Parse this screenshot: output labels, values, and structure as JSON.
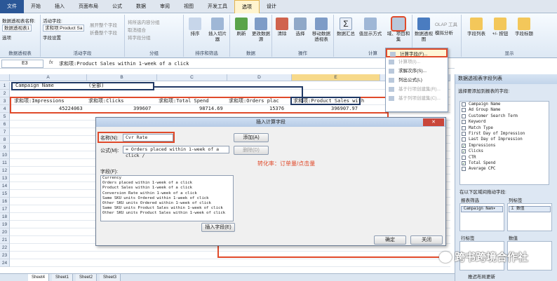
{
  "ribbon_tabs": [
    "文件",
    "开始",
    "插入",
    "页面布局",
    "公式",
    "数据",
    "审阅",
    "视图",
    "开发工具",
    "选项",
    "设计"
  ],
  "ribbon": {
    "pivot_name_label": "数据透视表名称:",
    "pivot_name": "数据透视表1",
    "active_field_label": "活动字段:",
    "active_field": "求和项:Product Sa",
    "options": "选项",
    "field_settings": "字段设置",
    "expand": "展开整个字段",
    "collapse": "折叠整个字段",
    "group_sel": "将所选内容分组",
    "ungroup": "取消组合",
    "group_field": "将字段分组",
    "sort": "排序",
    "insert_slicer": "插入切片器",
    "refresh": "刷新",
    "change_source": "更改数据源",
    "clear": "清除",
    "select": "选择",
    "move_pivot": "移动数据透视表",
    "summarize": "数据汇总",
    "show_values_as": "值显示方式",
    "fields_items_sets": "域、项目和集",
    "pivot_chart": "数据透视图",
    "olap": "OLAP 工具",
    "what_if": "模拟分析",
    "field_list": "字段列表",
    "plus_minus": "+/- 按钮",
    "field_headers": "字段标题",
    "groups": [
      "数据透视表",
      "活动字段",
      "分组",
      "排序和筛选",
      "数据",
      "操作",
      "计算",
      "工具",
      "显示"
    ]
  },
  "menu": {
    "items": [
      "计算字段(F)...",
      "计算项(I)...",
      "求解次序(S)...",
      "列出公式(L)",
      "基于行项创建集(R)...",
      "基于列项创建集(C)..."
    ],
    "dim": [
      false,
      true,
      false,
      false,
      true,
      true
    ]
  },
  "formula_bar": {
    "cell": "E3",
    "fx": "fx",
    "formula": "求和项:Product Sales within 1-week of a click"
  },
  "columns": [
    "A",
    "B",
    "C",
    "D",
    "E"
  ],
  "rows": [
    "1",
    "2",
    "3",
    "4",
    "5",
    "6",
    "7",
    "8",
    "9",
    "10",
    "11",
    "12",
    "13",
    "14",
    "15",
    "16",
    "17",
    "18",
    "19",
    "20",
    "21",
    "22",
    "23",
    "24"
  ],
  "sheet": {
    "filter_label": "Campaign Name",
    "filter_value": "(全部)",
    "headers": [
      "求和项:Impressions",
      "求和项:Clicks",
      "求和项:Total Spend",
      "求和项:Orders plac",
      "求和项:Product Sales with"
    ],
    "values": [
      "45224063",
      "399607",
      "98714.69",
      "15376",
      "396907.97"
    ]
  },
  "dialog": {
    "title": "插入计算字段",
    "close": "✕",
    "name_label": "名称(N):",
    "name_value": "Cvr Rate",
    "formula_label": "公式(M):",
    "formula_value": "= Orders placed within 1-week of a click /",
    "add": "添加(A)",
    "delete": "删除(D)",
    "annotation": "转化率：订单量/点击量",
    "fields_label": "字段(F):",
    "fields": [
      "Currency",
      "Orders placed within 1-week of a click",
      "Product Sales within 1-week of a click",
      "Conversion Rate within 1-week of a click",
      "Same SKU units Ordered within 1-week of click",
      "Other SKU units Ordered within 1-week of click",
      "Same SKU units Product Sales within 1-week of click",
      "Other SKU units Product Sales within 1-week of click"
    ],
    "insert_field": "插入字段(E)",
    "ok": "确定",
    "cancel": "关闭"
  },
  "pane": {
    "title": "数据透视表字段列表",
    "subtitle": "选择要添加到报表的字段:",
    "fields": [
      "Campaign Name",
      "Ad Group Name",
      "Customer Search Term",
      "Keyword",
      "Match Type",
      "First Day of Impression",
      "Last Day of Impression",
      "Impressions",
      "Clicks",
      "CTR",
      "Total Spend",
      "Average CPC"
    ],
    "checked": [
      false,
      false,
      false,
      false,
      false,
      false,
      false,
      true,
      true,
      false,
      true,
      false
    ],
    "drag_label": "在以下区域间拖动字段:",
    "filter_area": "报表筛选",
    "column_area": "列标签",
    "row_area": "行标签",
    "values_area": "数值",
    "filter_chip": "Campaign Nam▾",
    "column_chip": "Σ 数值",
    "defer_update": "推迟布局更新"
  },
  "sheet_tabs": [
    "Sheet4",
    "Sheet1",
    "Sheet2",
    "Sheet3"
  ],
  "watermark": "跨书跨境合作社"
}
